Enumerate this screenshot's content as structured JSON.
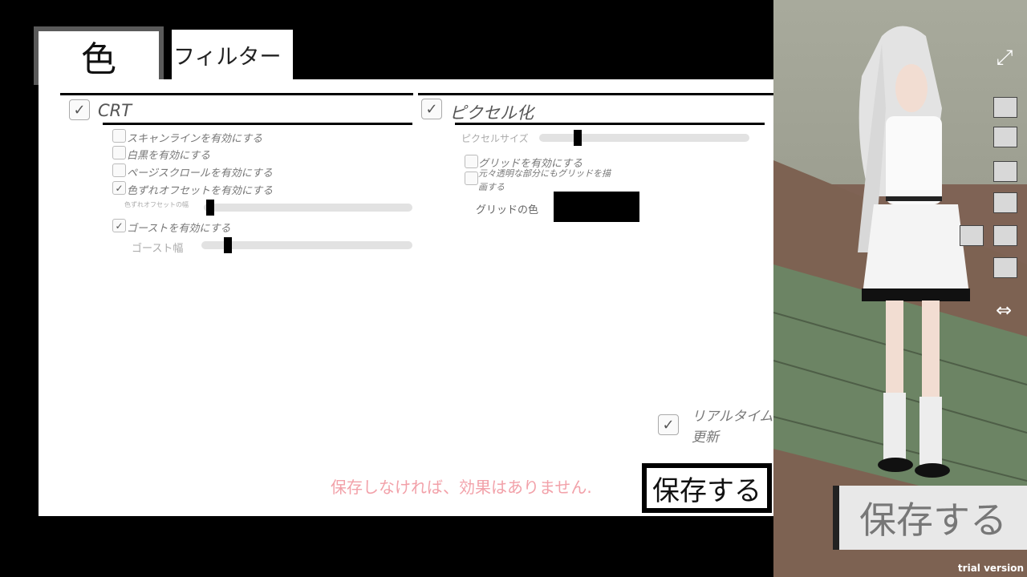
{
  "tabs": {
    "color_label": "色",
    "filter_label": "フィルター"
  },
  "crt": {
    "title": "CRT",
    "options": [
      "スキャンラインを有効にする",
      "白黒を有効にする",
      "ページスクロールを有効にする",
      "色ずれオフセットを有効にする"
    ],
    "offset_width_label": "色ずれオフセットの幅",
    "ghost_enable": "ゴーストを有効にする",
    "ghost_width_label": "ゴースト幅",
    "ghost_width_level": 0.11,
    "offset_width_level": 0.01
  },
  "pixel": {
    "title": "ピクセル化",
    "size_label": "ピクセルサイズ",
    "size_level": 0.17,
    "grid_enable": "グリッドを有効にする",
    "grid_transparent_line1": "元々透明な部分にもグリッドを描",
    "grid_transparent_line2": "画する",
    "grid_color_label": "グリッドの色",
    "grid_color": "#000000"
  },
  "realtime": {
    "line1": "リアルタイム",
    "line2": "更新"
  },
  "warning": "保存しなければ、効果はありません.",
  "save_label": "保存する",
  "save_big_label": "保存する",
  "trial": "trial version",
  "icons": [
    "expand-icon",
    "hair-icon",
    "face-icon",
    "top-icon",
    "bottom-icon",
    "socks-icon",
    "shoes-icon",
    "swap-icon"
  ]
}
